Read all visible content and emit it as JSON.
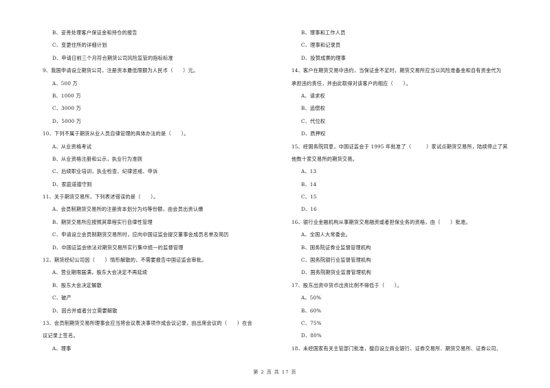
{
  "left_column": [
    {
      "type": "option",
      "text": "B、妥善处理客户保证金和持仓的报告"
    },
    {
      "type": "option",
      "text": "C、变更住所的详细计划"
    },
    {
      "type": "option",
      "text": "D、申请日前三个月符合期货公司风险监管的指标标准"
    },
    {
      "type": "question",
      "text": "9、我国申请设立期货公司，注册资本最低限额为人民币（　　）元。"
    },
    {
      "type": "option",
      "text": "A、500 万"
    },
    {
      "type": "option",
      "text": "B、1000 万"
    },
    {
      "type": "option",
      "text": "C、3000 万"
    },
    {
      "type": "option",
      "text": "D、5000 万"
    },
    {
      "type": "question",
      "text": "10、下列不属于期货从业人员自律管理的具体办法的是（　　）。"
    },
    {
      "type": "option",
      "text": "A、从业资格考试"
    },
    {
      "type": "option",
      "text": "B、从业资格注册和公示，执业行为准则"
    },
    {
      "type": "option",
      "text": "C、后续职业培训，执业检查、纪律惩戒、申诉"
    },
    {
      "type": "option",
      "text": "D、家庭道德守则"
    },
    {
      "type": "question",
      "text": "11、关于期货交易所，下列表述错误的是（　　）。"
    },
    {
      "type": "option",
      "text": "A、会员制期货交易所的注册资本划分为均等份额，由会员出资认缴"
    },
    {
      "type": "option",
      "text": "B、期货交易所应按照其章程实行自律性管理"
    },
    {
      "type": "option",
      "text": "C、申请设立会员制期货交易所时，应向中国证监会提交董事会成员名单及简历"
    },
    {
      "type": "option",
      "text": "D、中国证监会依法对期货交易所实行集中统一的监督管理"
    },
    {
      "type": "question",
      "text": "12、期货经纪公司因（　　）情形解散的，不需要报告中国证监会审批。"
    },
    {
      "type": "option",
      "text": "A、营业期限届满，股东大会决定不再延续"
    },
    {
      "type": "option",
      "text": "B、股东大会决定解散"
    },
    {
      "type": "option",
      "text": "C、破产"
    },
    {
      "type": "option",
      "text": "D、因合并或者分立需要解散"
    },
    {
      "type": "question",
      "text": "13、会员制期货交易所理事会应当将会议表决事项作成会议记录，由出席会议的（　　）在会"
    },
    {
      "type": "question",
      "text": "议记录上签名。"
    },
    {
      "type": "option",
      "text": "A、理事"
    }
  ],
  "right_column": [
    {
      "type": "option",
      "text": "B、理事和工作人员"
    },
    {
      "type": "option",
      "text": "C、理事和记录员"
    },
    {
      "type": "option",
      "text": "D、投赞成票的理事"
    },
    {
      "type": "question",
      "text": "14、客户在期货交易中违约，当保证金不足时，期货交易所应当以风险准备金和自有资金代为"
    },
    {
      "type": "question",
      "text": "承担违约责任，并由此取得对该客户的相应（　　）。"
    },
    {
      "type": "option",
      "text": "A、请求权"
    },
    {
      "type": "option",
      "text": "B、追偿权"
    },
    {
      "type": "option",
      "text": "C、代位权"
    },
    {
      "type": "option",
      "text": "D、质押权"
    },
    {
      "type": "question",
      "text": "15、经国务院同意，中国证监会于 1995 年批准了（　　　）家试点期货交易所，陆续停止了其"
    },
    {
      "type": "question",
      "text": "他数十家交易所的期货交易。"
    },
    {
      "type": "option",
      "text": "A、13"
    },
    {
      "type": "option",
      "text": "B、14"
    },
    {
      "type": "option",
      "text": "C、15"
    },
    {
      "type": "option",
      "text": "D、16"
    },
    {
      "type": "question",
      "text": "16、银行业金融机构从事期货交易融资或者担保业务的资格，由（　　）批准。"
    },
    {
      "type": "option",
      "text": "A、全国人大常委会。"
    },
    {
      "type": "option",
      "text": "B、国务院证券业监督管理机构"
    },
    {
      "type": "option",
      "text": "C、国务院银行业监督管理机构"
    },
    {
      "type": "option",
      "text": "D、国务院期货业监督管理机构"
    },
    {
      "type": "question",
      "text": "17、股东出资中货币出资比例不得低于（　　）。"
    },
    {
      "type": "option",
      "text": "A、50%"
    },
    {
      "type": "option",
      "text": "B、60%"
    },
    {
      "type": "option",
      "text": "C、75%"
    },
    {
      "type": "option",
      "text": "D、80%"
    },
    {
      "type": "question",
      "text": "18、未经国家有关主管部门批准，擅自设立商业银行、证券交易所、期货交易所、证券公司、"
    }
  ],
  "footer": {
    "page_label": "第 2 页 共 17 页"
  }
}
